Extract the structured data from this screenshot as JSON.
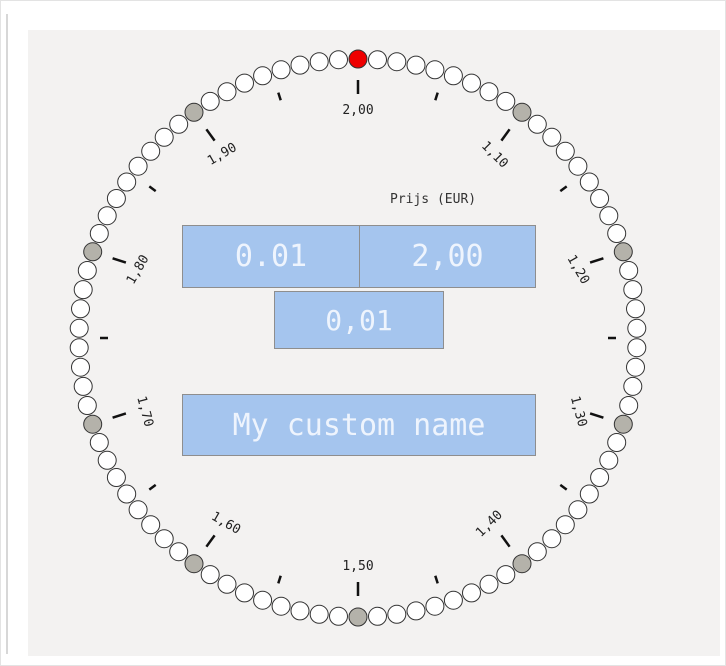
{
  "dial": {
    "tick_labels": [
      "2,00",
      "1,10",
      "1,20",
      "1,30",
      "1,40",
      "1,50",
      "1,60",
      "1,70",
      "1,80",
      "1,90"
    ],
    "dot_count": 90,
    "selected_index": 0,
    "colors": {
      "dot_fill": "#ffffff",
      "dot_major": "#b4b2aa",
      "dot_selected": "#ee0000",
      "dot_stroke": "#333333"
    }
  },
  "price_label": "Prijs (EUR)",
  "min_value": "0.01",
  "max_value": "2,00",
  "step_value": "0,01",
  "name_value": "My custom name"
}
